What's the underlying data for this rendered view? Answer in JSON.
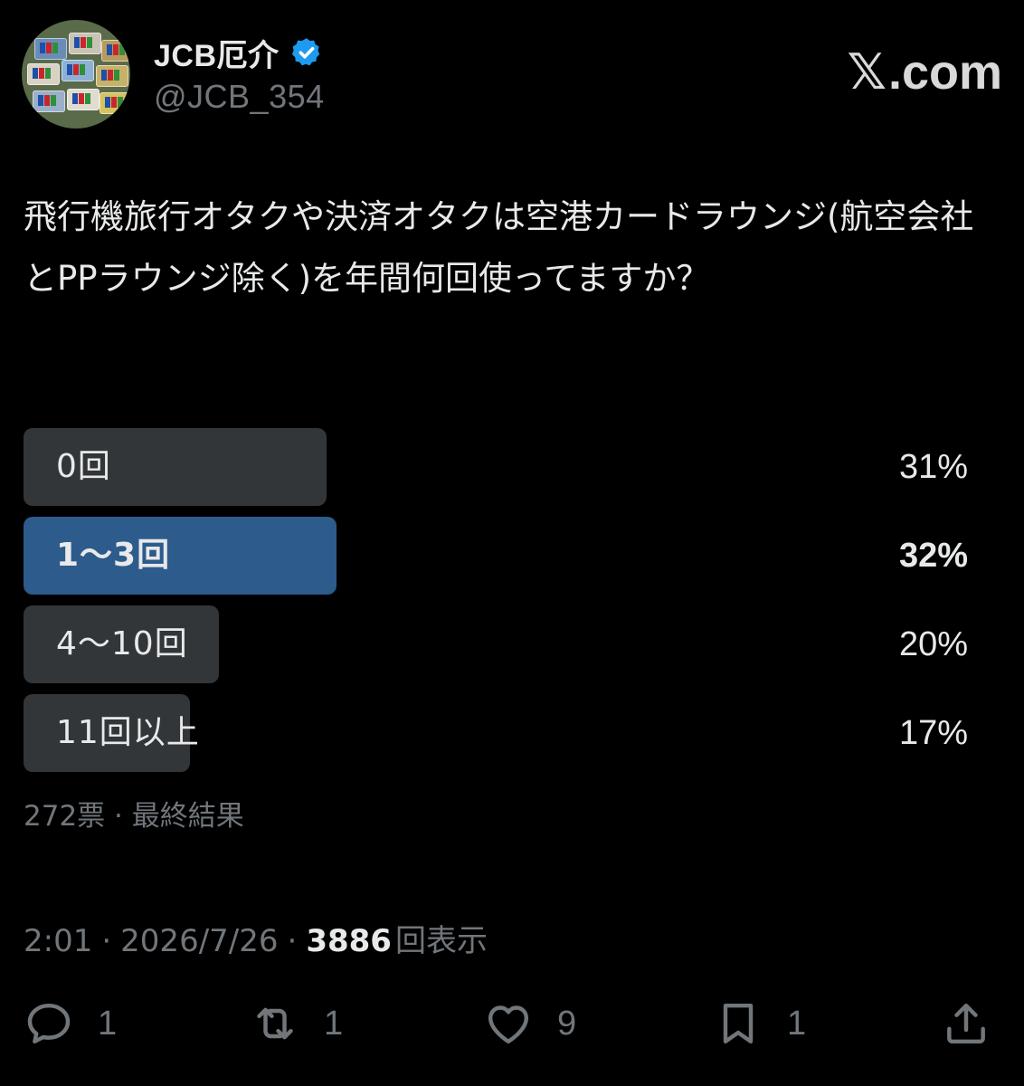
{
  "header": {
    "display_name": "JCB厄介",
    "handle": "@JCB_354",
    "brand_x": "𝕏",
    "brand_suffix": ".com",
    "verified_color": "#1d9bf0"
  },
  "tweet": {
    "text": "飛行機旅行オタクや決済オタクは空港カードラウンジ(航空会社とPPラウンジ除く)を年間何回使ってますか？"
  },
  "poll": {
    "options": [
      {
        "label": "0回",
        "percent": "31%",
        "value": 31,
        "winner": false
      },
      {
        "label": "1〜3回",
        "percent": "32%",
        "value": 32,
        "winner": true
      },
      {
        "label": "4〜10回",
        "percent": "20%",
        "value": 20,
        "winner": false
      },
      {
        "label": "11回以上",
        "percent": "17%",
        "value": 17,
        "winner": false
      }
    ],
    "meta": "272票 · 最終結果",
    "colors": {
      "bar": "#333639",
      "winner_bar": "#2d5b8c"
    }
  },
  "meta": {
    "time": "2:01",
    "date": "2026/7/26",
    "views_count": "3886",
    "views_label": "回表示"
  },
  "actions": {
    "reply_count": "1",
    "repost_count": "1",
    "like_count": "9",
    "bookmark_count": "1",
    "icons": [
      "reply-icon",
      "repost-icon",
      "like-icon",
      "bookmark-icon",
      "share-icon"
    ]
  }
}
